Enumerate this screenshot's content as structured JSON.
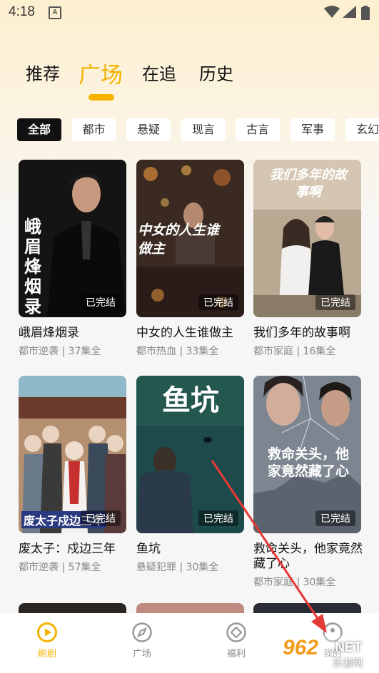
{
  "status": {
    "time": "4:18",
    "notification_glyph": "A"
  },
  "top_tabs": [
    {
      "label": "推荐",
      "active": false
    },
    {
      "label": "广场",
      "active": true
    },
    {
      "label": "在追",
      "active": false
    },
    {
      "label": "历史",
      "active": false
    }
  ],
  "filters": [
    {
      "label": "全部",
      "active": true
    },
    {
      "label": "都市",
      "active": false
    },
    {
      "label": "悬疑",
      "active": false
    },
    {
      "label": "现言",
      "active": false
    },
    {
      "label": "古言",
      "active": false
    },
    {
      "label": "军事",
      "active": false
    },
    {
      "label": "玄幻",
      "active": false
    }
  ],
  "cards": [
    {
      "title": "峨眉烽烟录",
      "meta": "都市逆袭 | 37集全",
      "badge": "已完结",
      "poster_text": "峨眉烽烟录"
    },
    {
      "title": "中女的人生谁做主",
      "meta": "都市热血 | 33集全",
      "badge": "已完结",
      "poster_text": "中女的人生谁做主"
    },
    {
      "title": "我们多年的故事啊",
      "meta": "都市家庭 | 16集全",
      "badge": "已完结",
      "poster_text": "我们多年的故事啊"
    },
    {
      "title": "废太子：戍边三年",
      "meta": "都市逆袭 | 57集全",
      "badge": "已完结",
      "poster_text": "废太子戍边三年"
    },
    {
      "title": "鱼坑",
      "meta": "悬疑犯罪 | 30集全",
      "badge": "已完结",
      "poster_text": "鱼坑"
    },
    {
      "title": "救命关头，他家竟然藏了心",
      "meta": "都市家庭 | 30集全",
      "badge": "已完结",
      "poster_text": "救命关头，他家竟然藏了心"
    }
  ],
  "bottom_nav": [
    {
      "label": "刷剧",
      "icon": "play-icon",
      "active": true
    },
    {
      "label": "广场",
      "icon": "compass-icon",
      "active": false
    },
    {
      "label": "福利",
      "icon": "gift-icon",
      "active": false
    },
    {
      "label": "我的",
      "icon": "profile-icon",
      "active": false
    }
  ],
  "watermark": {
    "number": "962",
    "suffix": ".NET",
    "site": "乐游网"
  },
  "colors": {
    "accent": "#f5b300",
    "annotation_arrow": "#e53935"
  }
}
